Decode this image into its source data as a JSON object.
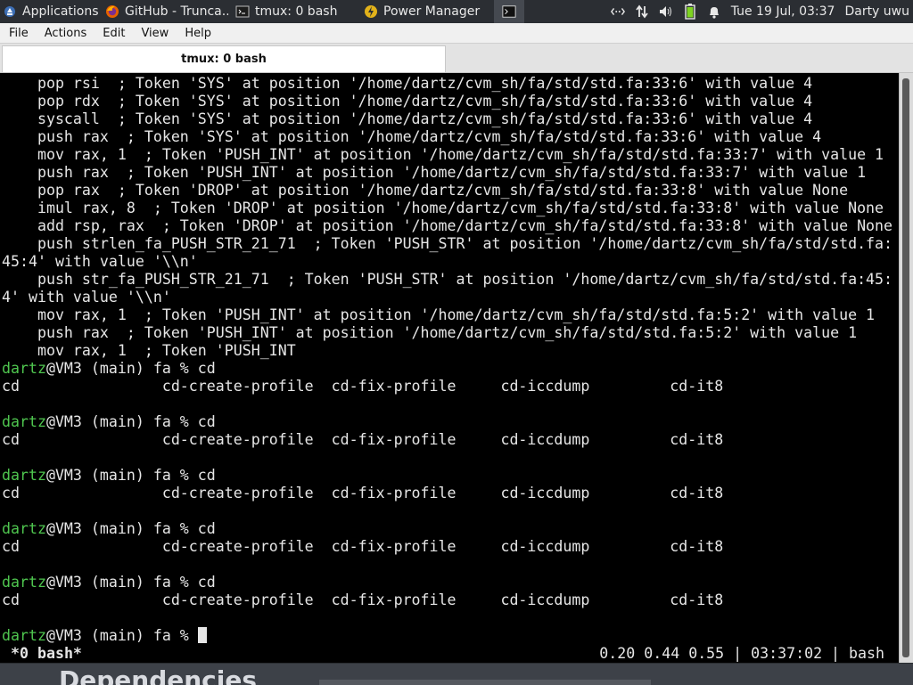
{
  "panel": {
    "tasks": [
      {
        "label": "Applications",
        "icon": "applications-icon"
      },
      {
        "label": "GitHub - Trunca...",
        "icon": "firefox-icon"
      },
      {
        "label": "tmux: 0 bash",
        "icon": "terminal-icon"
      },
      {
        "label": "Power Manager",
        "icon": "power-manager-icon"
      },
      {
        "label": "",
        "icon": "terminal-icon"
      }
    ],
    "tray": {
      "icons": [
        "network-icon",
        "transfer-icon",
        "volume-icon",
        "battery-icon",
        "notification-bell-icon"
      ],
      "clock": "Tue 19 Jul, 03:37",
      "user": "Darty uwu"
    }
  },
  "menubar": {
    "file": "File",
    "actions": "Actions",
    "edit": "Edit",
    "view": "View",
    "help": "Help"
  },
  "tab": {
    "title": "tmux: 0 bash"
  },
  "terminal": {
    "lines": [
      "    pop rsi  ; Token 'SYS' at position '/home/dartz/cvm_sh/fa/std/std.fa:33:6' with value 4",
      "    pop rdx  ; Token 'SYS' at position '/home/dartz/cvm_sh/fa/std/std.fa:33:6' with value 4",
      "    syscall  ; Token 'SYS' at position '/home/dartz/cvm_sh/fa/std/std.fa:33:6' with value 4",
      "    push rax  ; Token 'SYS' at position '/home/dartz/cvm_sh/fa/std/std.fa:33:6' with value 4",
      "    mov rax, 1  ; Token 'PUSH_INT' at position '/home/dartz/cvm_sh/fa/std/std.fa:33:7' with value 1",
      "    push rax  ; Token 'PUSH_INT' at position '/home/dartz/cvm_sh/fa/std/std.fa:33:7' with value 1",
      "    pop rax  ; Token 'DROP' at position '/home/dartz/cvm_sh/fa/std/std.fa:33:8' with value None",
      "    imul rax, 8  ; Token 'DROP' at position '/home/dartz/cvm_sh/fa/std/std.fa:33:8' with value None",
      "    add rsp, rax  ; Token 'DROP' at position '/home/dartz/cvm_sh/fa/std/std.fa:33:8' with value None",
      "    push strlen_fa_PUSH_STR_21_71  ; Token 'PUSH_STR' at position '/home/dartz/cvm_sh/fa/std/std.fa:",
      "45:4' with value '\\\\n'",
      "    push str_fa_PUSH_STR_21_71  ; Token 'PUSH_STR' at position '/home/dartz/cvm_sh/fa/std/std.fa:45:",
      "4' with value '\\\\n'",
      "    mov rax, 1  ; Token 'PUSH_INT' at position '/home/dartz/cvm_sh/fa/std/std.fa:5:2' with value 1",
      "    push rax  ; Token 'PUSH_INT' at position '/home/dartz/cvm_sh/fa/std/std.fa:5:2' with value 1",
      "    mov rax, 1  ; Token 'PUSH_INT"
    ],
    "prompt_user": "dartz",
    "prompt_rest": "@VM3 (main) fa % ",
    "blocks": [
      {
        "cmd": "cd",
        "completions": "cd                cd-create-profile  cd-fix-profile     cd-iccdump         cd-it8"
      },
      {
        "cmd": "cd",
        "completions": "cd                cd-create-profile  cd-fix-profile     cd-iccdump         cd-it8"
      },
      {
        "cmd": "cd",
        "completions": "cd                cd-create-profile  cd-fix-profile     cd-iccdump         cd-it8"
      },
      {
        "cmd": "cd",
        "completions": "cd                cd-create-profile  cd-fix-profile     cd-iccdump         cd-it8"
      },
      {
        "cmd": "cd",
        "completions": "cd                cd-create-profile  cd-fix-profile     cd-iccdump         cd-it8"
      }
    ]
  },
  "statusline": {
    "left": "*0 bash*",
    "right": "0.20 0.44 0.55 | 03:37:02 | bash"
  },
  "background_window": {
    "heading": "Dependencies"
  },
  "colors": {
    "prompt_user": "#4fc64f",
    "terminal_bg": "#000000",
    "terminal_fg": "#e6e6e6",
    "panel_bg": "#2b2e33"
  }
}
